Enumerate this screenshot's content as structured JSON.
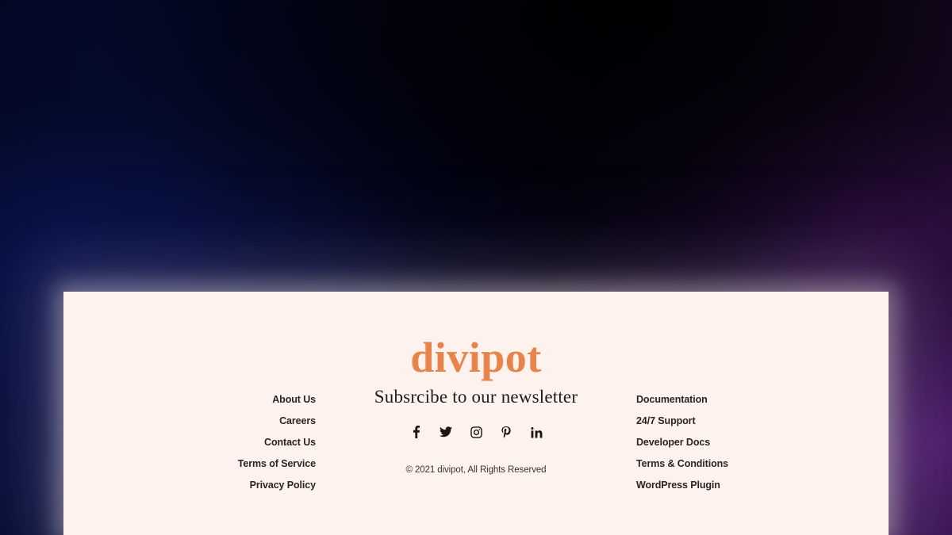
{
  "background": {
    "navy": "#030a2a",
    "black": "#040212",
    "purple": "#240e34",
    "blue_glow": "#0e1a5c",
    "purple_glow": "#561e78"
  },
  "footer": {
    "card_background": "#fdf2ee",
    "brand": {
      "name": "divipot",
      "color": "#e8834a"
    },
    "left_links": [
      {
        "label": "About Us"
      },
      {
        "label": "Careers"
      },
      {
        "label": "Contact Us"
      },
      {
        "label": "Terms of Service"
      },
      {
        "label": "Privacy Policy"
      }
    ],
    "right_links": [
      {
        "label": "Documentation"
      },
      {
        "label": "24/7 Support"
      },
      {
        "label": "Developer Docs"
      },
      {
        "label": "Terms & Conditions"
      },
      {
        "label": "WordPress Plugin"
      }
    ],
    "newsletter": {
      "heading": "Subsrcibe to our newsletter"
    },
    "social": [
      {
        "name": "facebook-icon",
        "label": "Facebook"
      },
      {
        "name": "twitter-icon",
        "label": "Twitter"
      },
      {
        "name": "instagram-icon",
        "label": "Instagram"
      },
      {
        "name": "pinterest-icon",
        "label": "Pinterest"
      },
      {
        "name": "linkedin-icon",
        "label": "LinkedIn"
      }
    ],
    "copyright": "© 2021 divipot, All Rights Reserved",
    "text_color": "#2b2420"
  }
}
